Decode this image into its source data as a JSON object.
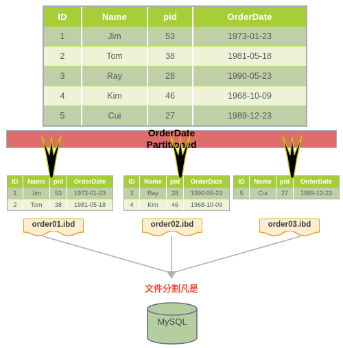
{
  "main_table": {
    "name": "orders-master-table",
    "columns": [
      "ID",
      "Name",
      "pid",
      "OrderDate"
    ],
    "rows": [
      [
        "1",
        "Jim",
        "53",
        "1973-01-23"
      ],
      [
        "2",
        "Tom",
        "38",
        "1981-05-18"
      ],
      [
        "3",
        "Ray",
        "28",
        "1990-05-23"
      ],
      [
        "4",
        "Kim",
        "46",
        "1968-10-09"
      ],
      [
        "5",
        "Cui",
        "27",
        "1989-12-23"
      ]
    ]
  },
  "banner": {
    "line1": "OrderDate",
    "line2": "Partitioned",
    "color": "#dd6e6b"
  },
  "partitions": [
    {
      "columns": [
        "ID",
        "Name",
        "pid",
        "OrderDate"
      ],
      "rows": [
        [
          "1",
          "Jim",
          "53",
          "1973-01-23"
        ],
        [
          "2",
          "Tom",
          "38",
          "1981-05-18"
        ]
      ],
      "file_label": "order01.ibd"
    },
    {
      "columns": [
        "ID",
        "Name",
        "pid",
        "OrderDate"
      ],
      "rows": [
        [
          "3",
          "Ray",
          "28",
          "1990-05-23"
        ],
        [
          "4",
          "Kim",
          "46",
          "1968-10-09"
        ]
      ],
      "file_label": "order02.ibd"
    },
    {
      "columns": [
        "ID",
        "Name",
        "pid",
        "OrderDate"
      ],
      "rows": [
        [
          "5",
          "Cui",
          "27",
          "1989-12-23"
        ]
      ],
      "file_label": "order03.ibd"
    }
  ],
  "caption": {
    "text": "文件分割凡是",
    "color": "#f0503c"
  },
  "database": {
    "label": "MySQL",
    "fill": "#b5ce9f",
    "stroke": "#6b6e8e"
  },
  "theme": {
    "header_green": "#a6ce39",
    "row_dark": "#bfcfa8",
    "row_light": "#eef3d8",
    "label_fill": "#fdeed2",
    "label_border": "#e2a521",
    "connector": "#b0b0b0"
  }
}
